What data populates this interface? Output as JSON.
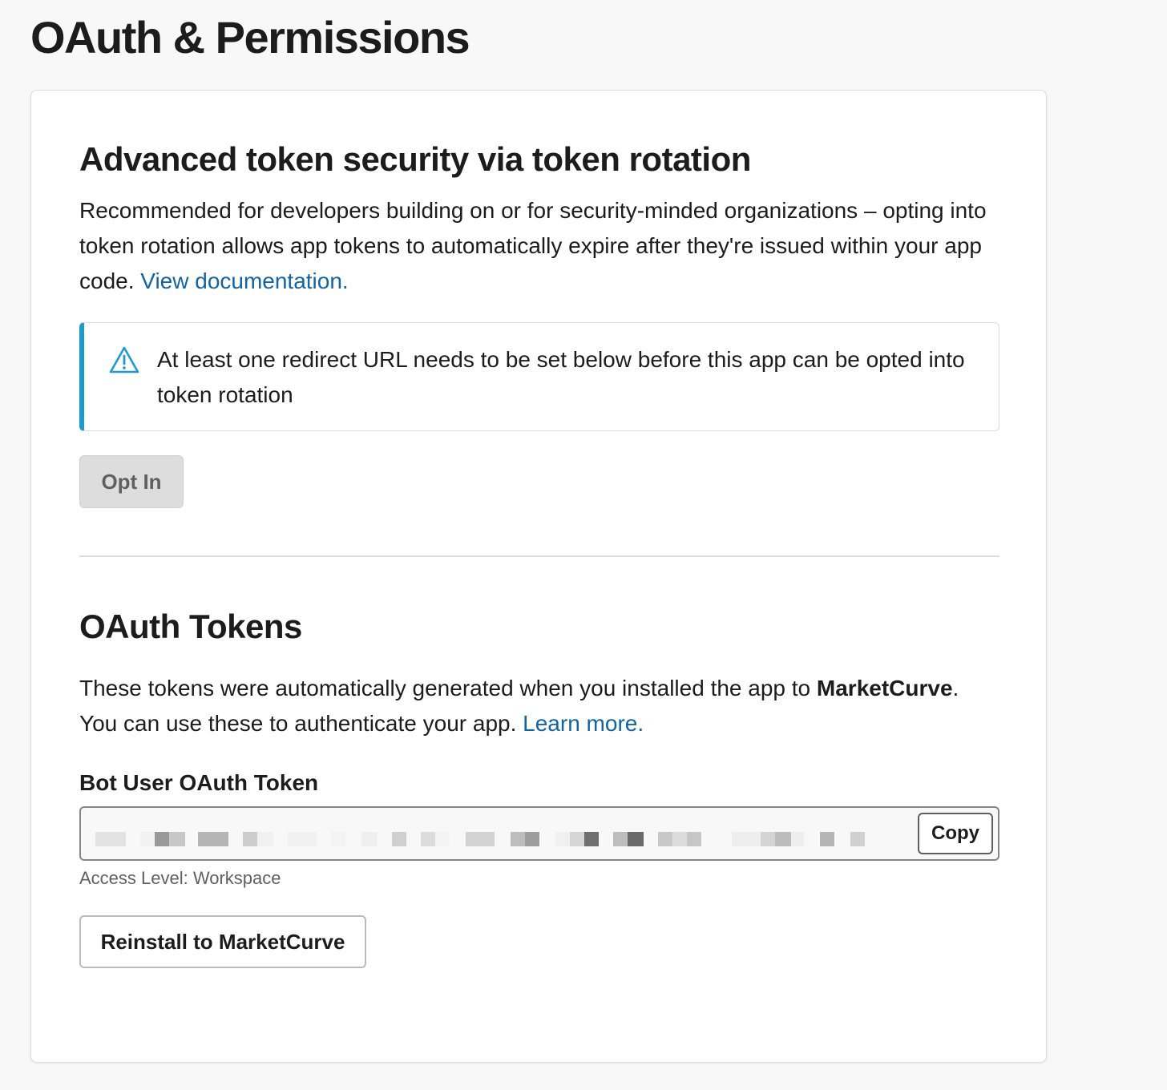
{
  "page": {
    "title": "OAuth & Permissions"
  },
  "rotation": {
    "title": "Advanced token security via token rotation",
    "description": "Recommended for developers building on or for security-minded organizations – opting into token rotation allows app tokens to automatically expire after they're issued within your app code.",
    "doc_link": "View documentation.",
    "warning_text": "At least one redirect URL needs to be set below before this app can be opted into token rotation",
    "opt_in_label": "Opt In"
  },
  "tokens": {
    "title": "OAuth Tokens",
    "description_prefix": "These tokens were automatically generated when you installed the app to",
    "workspace_name": "MarketCurve",
    "description_middle": ". You can use these to authenticate your app.",
    "learn_more": "Learn more.",
    "bot_token_label": "Bot User OAuth Token",
    "copy_label": "Copy",
    "access_level": "Access Level: Workspace",
    "reinstall_label": "Reinstall to MarketCurve"
  },
  "icons": {
    "warning": "warning-triangle-icon"
  },
  "colors": {
    "accent_link": "#1264a3",
    "warning_bar": "#1d9bd1",
    "text": "#1d1c1d",
    "muted": "#616061"
  }
}
